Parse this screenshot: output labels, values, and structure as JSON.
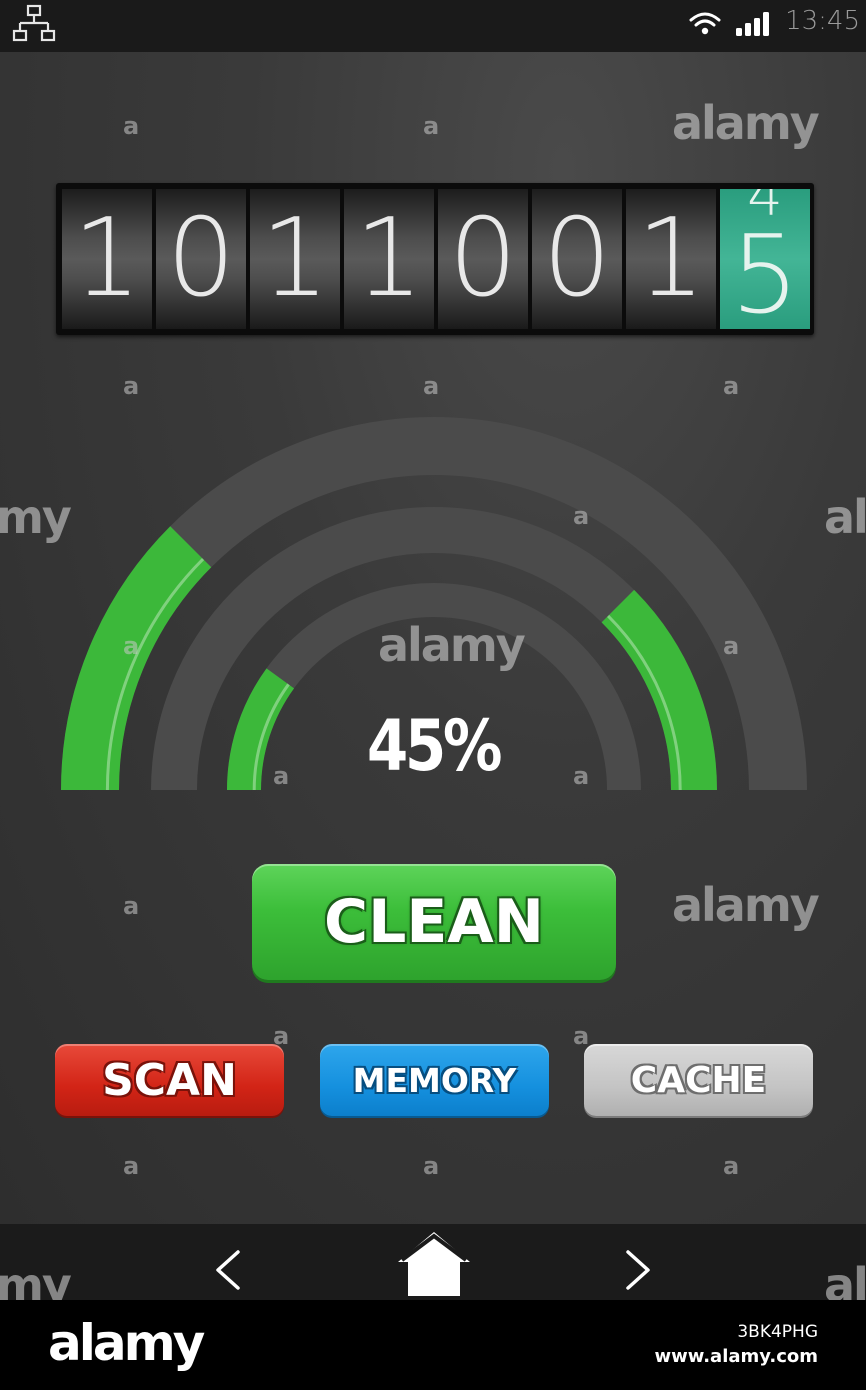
{
  "status_bar": {
    "time": "13:45",
    "icons": [
      "network-icon",
      "wifi-icon",
      "signal-icon"
    ]
  },
  "counter": {
    "digits": [
      "1",
      "0",
      "1",
      "1",
      "0",
      "0",
      "1"
    ],
    "last_digit_prev": "4",
    "last_digit_current": "5",
    "last_digit_color": "#3aaa8c"
  },
  "gauge": {
    "percent_label": "45%",
    "progress_outer": 0.25,
    "progress_middle": 0.25,
    "progress_inner": 0.2,
    "fill_color": "#3cb83a",
    "track_color": "#4b4b4b"
  },
  "buttons": {
    "clean_label": "CLEAN",
    "scan_label": "SCAN",
    "memory_label": "MEMORY",
    "cache_label": "CACHE"
  },
  "nav_bar": {
    "icons": [
      "back-icon",
      "home-icon",
      "forward-icon"
    ]
  },
  "watermark": {
    "brand": "alamy",
    "letter": "a",
    "fragment_left": "my",
    "fragment_right": "ala"
  },
  "footer": {
    "logo": "alamy",
    "image_id": "3BK4PHG",
    "url": "www.alamy.com"
  }
}
